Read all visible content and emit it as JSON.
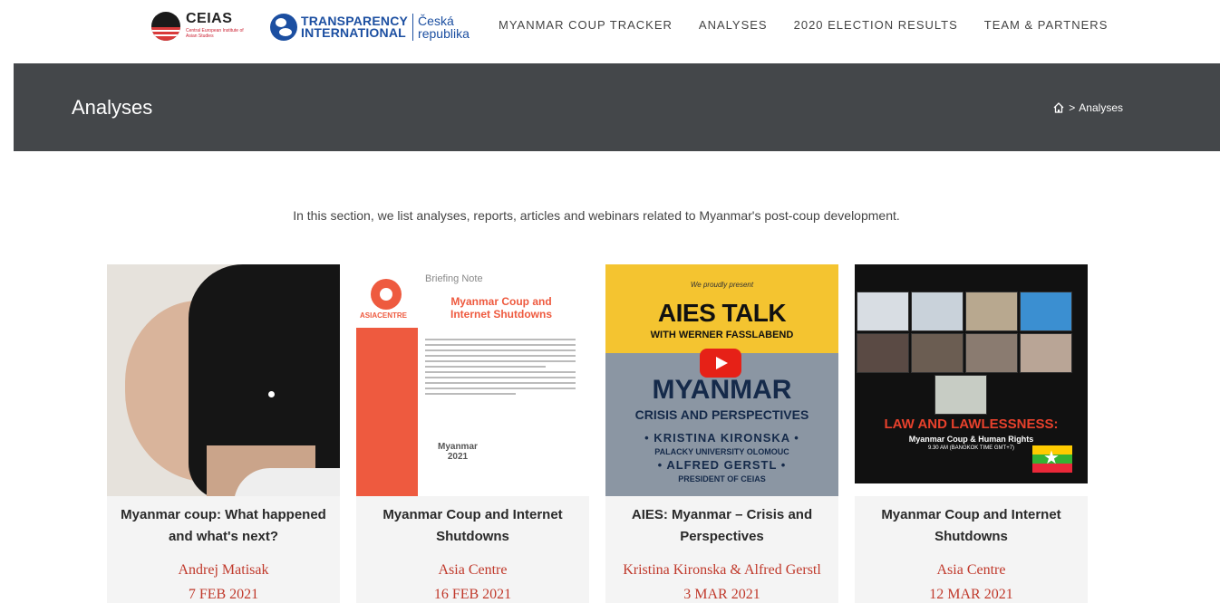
{
  "header": {
    "ceias": {
      "name": "CEIAS",
      "sub": "Central European Institute of Asian Studies"
    },
    "ti": {
      "line1": "TRANSPARENCY",
      "line2": "INTERNATIONAL",
      "cz1": "Česká",
      "cz2": "republika"
    },
    "nav": [
      {
        "label": "MYANMAR COUP TRACKER"
      },
      {
        "label": "ANALYSES"
      },
      {
        "label": "2020 ELECTION RESULTS"
      },
      {
        "label": "TEAM & PARTNERS"
      }
    ]
  },
  "banner": {
    "title": "Analyses",
    "breadcrumb": {
      "separator": ">",
      "current": "Analyses",
      "home_icon": "home-icon"
    }
  },
  "intro": "In this section, we list analyses, reports, articles and webinars related to Myanmar's post-coup development.",
  "cards": [
    {
      "title_line1": "Myanmar coup: What happened",
      "title_line2": "and what's next?",
      "author": "Andrej Matisak",
      "date": "7 FEB 2021"
    },
    {
      "title_line1": "Myanmar Coup and Internet",
      "title_line2": "Shutdowns",
      "author": "Asia Centre",
      "date": "16 FEB 2021",
      "image": {
        "org": "ASIACENTRE",
        "label": "Briefing Note",
        "title": "Myanmar Coup and Internet Shutdowns",
        "country": "Myanmar",
        "year": "2021"
      }
    },
    {
      "title_line1": "AIES: Myanmar – Crisis and",
      "title_line2": "Perspectives",
      "author": "Kristina Kironska & Alfred Gerstl",
      "date": "3 MAR 2021",
      "image": {
        "intro": "We proudly present",
        "talk": "AIES TALK",
        "with": "WITH WERNER FASSLABEND",
        "country": "MYANMAR",
        "subtitle": "CRISIS AND PERSPECTIVES",
        "speaker1": "• KRISTINA KIRONSKA •",
        "affil1": "PALACKY UNIVERSITY OLOMOUC",
        "speaker2": "• ALFRED GERSTL •",
        "affil2": "PRESIDENT OF CEIAS",
        "play_icon": "play-icon"
      }
    },
    {
      "title_line1": "Myanmar Coup and Internet",
      "title_line2": "Shutdowns",
      "author": "Asia Centre",
      "date": "12 MAR 2021",
      "image": {
        "headline": "LAW AND LAWLESSNESS:",
        "sub": "Myanmar Coup & Human Rights",
        "time": "9.30 AM (BANGKOK TIME GMT+7)"
      }
    }
  ],
  "colors": {
    "banner_bg": "#44474a",
    "accent_red": "#c0392b",
    "card_bg": "#f4f4f4",
    "ti_blue": "#1c4fa1"
  }
}
